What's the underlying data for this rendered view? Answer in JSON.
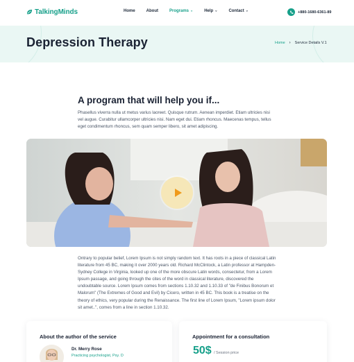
{
  "brand": {
    "name": "TalkingMinds",
    "accent": "#17a08a"
  },
  "nav": [
    {
      "label": "Home",
      "has_dropdown": false,
      "active": false
    },
    {
      "label": "About",
      "has_dropdown": false,
      "active": false
    },
    {
      "label": "Programs",
      "has_dropdown": true,
      "active": true
    },
    {
      "label": "Help",
      "has_dropdown": true,
      "active": false
    },
    {
      "label": "Contact",
      "has_dropdown": true,
      "active": false
    }
  ],
  "phone": {
    "icon": "phone-icon",
    "number": "+880-1680-6361-89"
  },
  "hero": {
    "title": "Depression Therapy",
    "breadcrumb": {
      "home": "Home",
      "separator": "›",
      "current": "Service Details V.1"
    }
  },
  "program": {
    "title": "A program that will help you if...",
    "description": "Phasellus viverra nulla ut metus varius laoreet. Quisque rutrum. Aenean imperdiet. Etiam ultricies nisi vel augue. Curabitur ullamcorper ultricies nisi. Nam eget dui. Etiam rhoncus. Maecenas tempus, tellus eget condimentum rhoncus, sem quam semper libero, sit amet adipiscing."
  },
  "video": {
    "play_icon": "play-icon"
  },
  "body_text": "Ontrary to popular belief, Lorem Ipsum is not simply random text. It has roots in a piece of classical Latin literature from 45 BC, making it over 2000 years old. Richard McClintock, a Latin professor at Hampden-Sydney College in Virginia, looked up one of the more obscure Latin words, consectetur, from a Lorem Ipsum passage, and going through the cites of the word in classical literature, discovered the undoubtable source. Lorem Ipsum comes from sections 1.10.32 and 1.10.33 of \"de Finibus Bonorum et Malorum\" (The Extremes of Good and Evil) by Cicero, written in 45 BC. This book is a treatise on the theory of ethics, very popular during the Renaissance. The first line of Lorem Ipsum, \"Lorem ipsum dolor sit amet..\", comes from a line in section 1.10.32.",
  "author_card": {
    "title": "About the author of the service",
    "name": "Dr. Merry Rose",
    "role": "Practicing psychologist, Psy. D"
  },
  "appointment_card": {
    "title": "Appointment for a consultation",
    "price": "50$",
    "price_label": "/ Session price"
  }
}
